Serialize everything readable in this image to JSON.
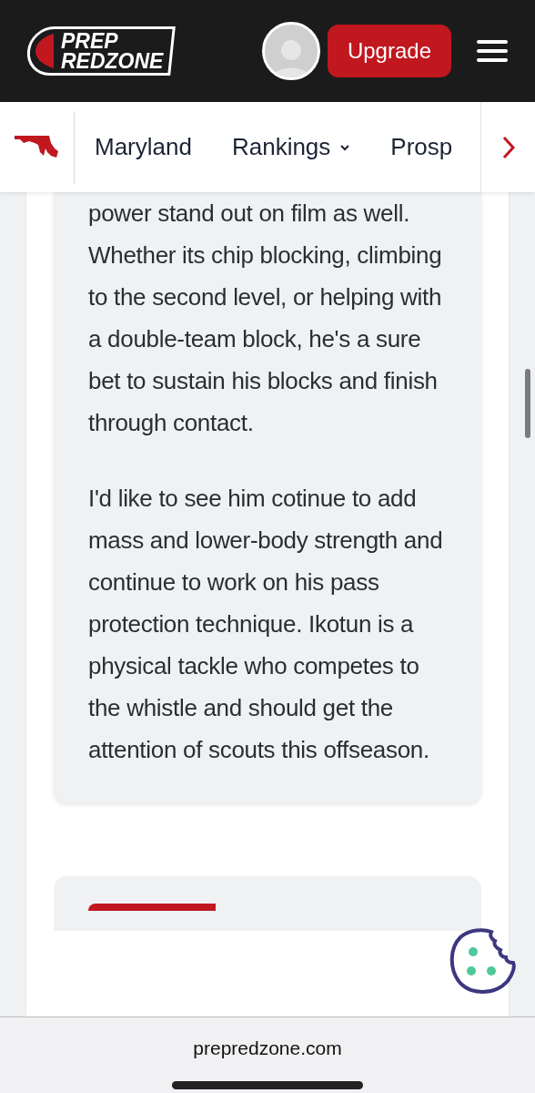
{
  "header": {
    "logo_line_1": "PREP",
    "logo_line_2": "REDZONE",
    "upgrade_button": "Upgrade"
  },
  "nav": {
    "items": [
      {
        "label": "Maryland",
        "dropdown": false
      },
      {
        "label": "Rankings",
        "dropdown": true
      },
      {
        "label": "Prosp",
        "dropdown": false
      }
    ]
  },
  "article": {
    "paragraphs": [
      "power stand out on film as well. Whether its chip blocking, climbing to the second level, or helping with a double-team block, he's a sure bet to sustain his blocks and finish through contact.",
      "I'd like to see him cotinue to add mass and lower-body strength and continue to work on his pass protection technique. Ikotun is a physical tackle who competes to the whistle and should get the attention of scouts this offseason."
    ]
  },
  "browser_bar": {
    "url": "prepredzone.com"
  }
}
